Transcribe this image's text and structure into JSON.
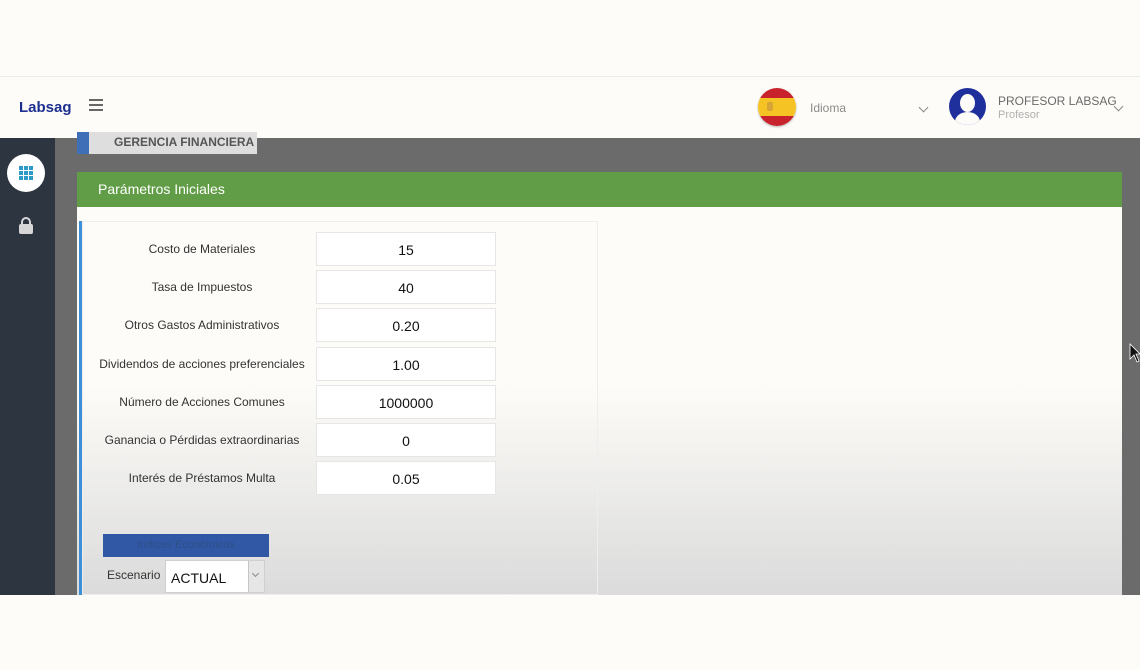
{
  "header": {
    "brand": "Labsag",
    "language_label": "Idioma",
    "user_name": "PROFESOR LABSAG",
    "user_role": "Profesor"
  },
  "tab_label": "GERENCIA FINANCIERA",
  "panel": {
    "title": "Parámetros Iniciales",
    "fields": [
      {
        "label": "Costo de Materiales",
        "value": "15"
      },
      {
        "label": "Tasa de Impuestos",
        "value": "40"
      },
      {
        "label": "Otros Gastos Administrativos",
        "value": "0.20"
      },
      {
        "label": "Dividendos de acciones preferenciales",
        "value": "1.00"
      },
      {
        "label": "Número de Acciones Comunes",
        "value": "1000000"
      },
      {
        "label": "Ganancia o Pérdidas extraordinarias",
        "value": "0"
      },
      {
        "label": "Interés de Préstamos Multa",
        "value": "0.05"
      }
    ],
    "indices_button": "Indices Económicos",
    "scenario_label": "Escenario",
    "scenario_value": "ACTUAL"
  },
  "icons": {
    "flag": "spain-flag-icon",
    "avatar": "user-avatar-icon",
    "apps": "grid-icon",
    "lock": "lock-icon",
    "menu": "hamburger-icon"
  },
  "colors": {
    "brand": "#1d2f8f",
    "panel_header": "#619d46",
    "sidebar": "#2d3540",
    "accent": "#3e8ed8",
    "indices_button": "#3158a4"
  }
}
